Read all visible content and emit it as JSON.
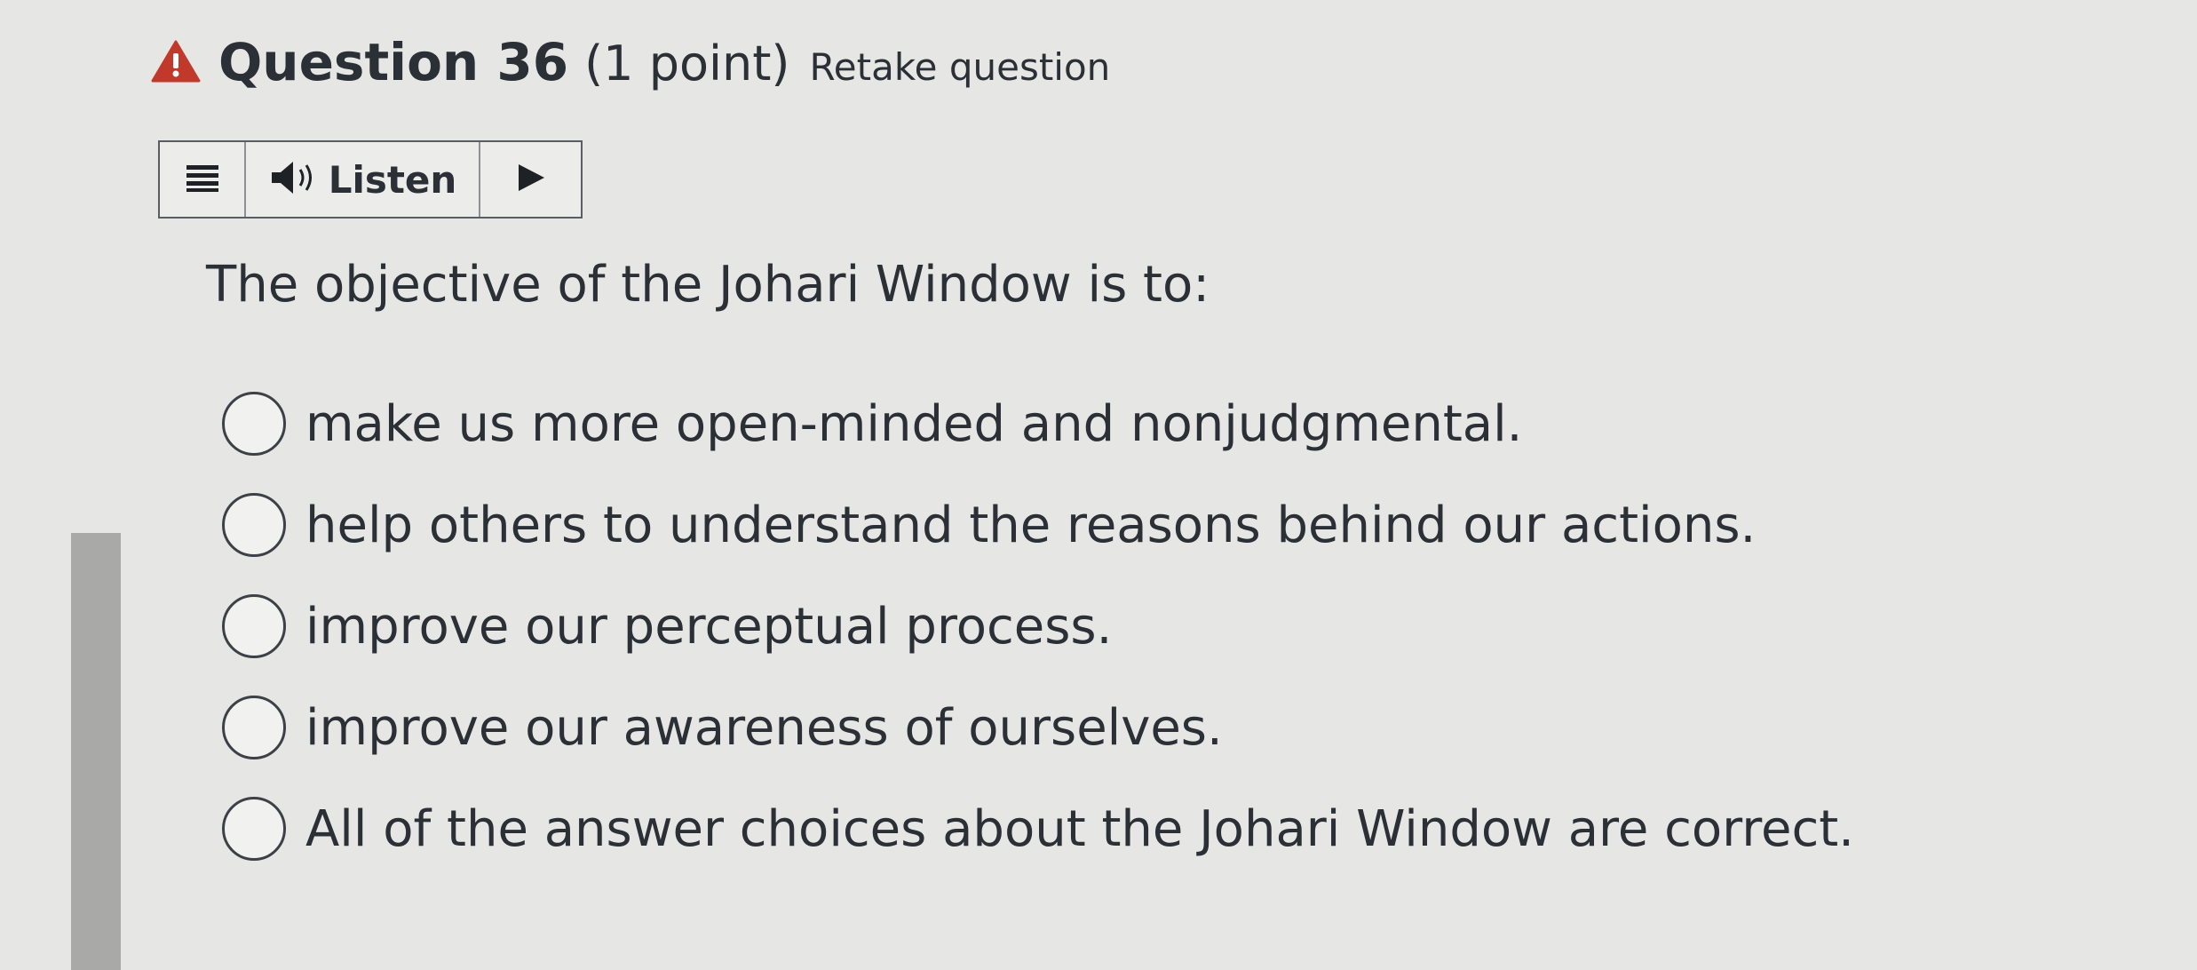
{
  "question": {
    "title": "Question 36",
    "points": "(1 point)",
    "retake": "Retake question",
    "warning_icon": "warning-triangle-icon",
    "warning_color": "#c0392b"
  },
  "listen_bar": {
    "menu_icon": "menu-lines-icon",
    "speaker_icon": "speaker-icon",
    "listen_label": "Listen",
    "play_icon": "play-icon"
  },
  "prompt": "The objective of the Johari Window is to:",
  "options": [
    {
      "label": "make us more open-minded and nonjudgmental.",
      "selected": false
    },
    {
      "label": "help others to understand the reasons behind our actions.",
      "selected": false
    },
    {
      "label": "improve our perceptual process.",
      "selected": false
    },
    {
      "label": "improve our awareness of ourselves.",
      "selected": false
    },
    {
      "label": "All of the answer choices about the Johari Window are correct.",
      "selected": false
    }
  ]
}
